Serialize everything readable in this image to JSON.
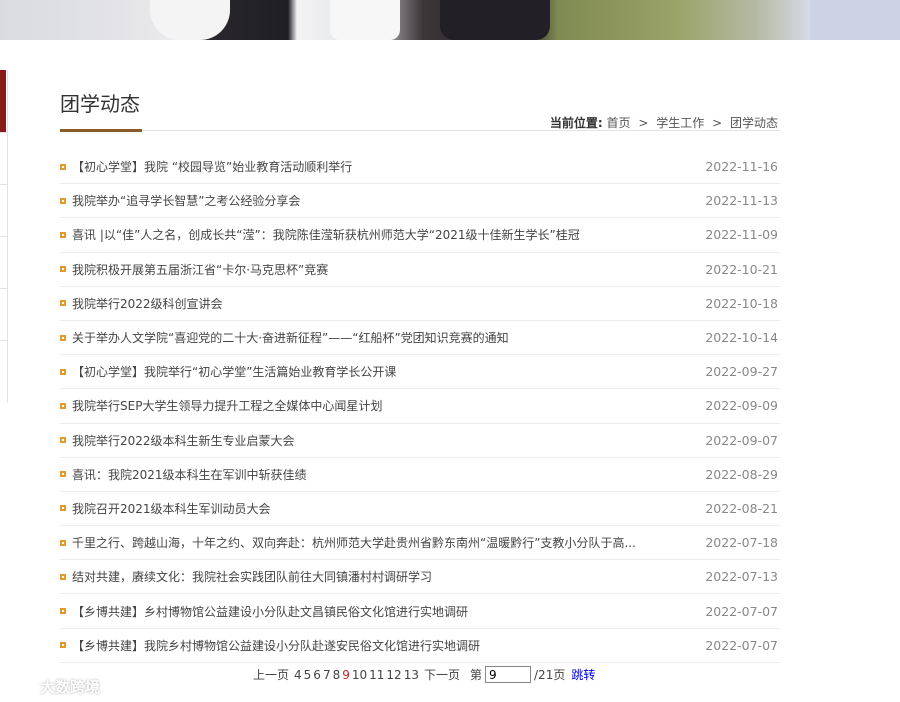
{
  "header": {
    "title": "团学动态",
    "breadcrumb_label": "当前位置:",
    "breadcrumb": [
      "首页",
      "学生工作",
      "团学动态"
    ],
    "breadcrumb_sep": ">"
  },
  "colors": {
    "accent": "#8b5a2b",
    "bullet": "#e39a2a",
    "current_page": "#c02626",
    "sidenav_active": "#8b1a1a"
  },
  "news": [
    {
      "title": "【初心学堂】我院 “校园导览”始业教育活动顺利举行",
      "date": "2022-11-16"
    },
    {
      "title": "我院举办“追寻学长智慧”之考公经验分享会",
      "date": "2022-11-13"
    },
    {
      "title": "喜讯 |以“佳”人之名，创成长共“滢”：我院陈佳滢斩获杭州师范大学“2021级十佳新生学长”桂冠",
      "date": "2022-11-09"
    },
    {
      "title": "我院积极开展第五届浙江省“卡尔·马克思杯”竞赛",
      "date": "2022-10-21"
    },
    {
      "title": "我院举行2022级科创宣讲会",
      "date": "2022-10-18"
    },
    {
      "title": "关于举办人文学院“喜迎党的二十大·奋进新征程”——“红船杯”党团知识竞赛的通知",
      "date": "2022-10-14"
    },
    {
      "title": "【初心学堂】我院举行“初心学堂”生活篇始业教育学长公开课",
      "date": "2022-09-27"
    },
    {
      "title": "我院举行SEP大学生领导力提升工程之全媒体中心闻星计划",
      "date": "2022-09-09"
    },
    {
      "title": "我院举行2022级本科生新生专业启蒙大会",
      "date": "2022-09-07"
    },
    {
      "title": "喜讯：我院2021级本科生在军训中斩获佳绩",
      "date": "2022-08-29"
    },
    {
      "title": "我院召开2021级本科生军训动员大会",
      "date": "2022-08-21"
    },
    {
      "title": "千里之行、跨越山海，十年之约、双向奔赴：杭州师范大学赴贵州省黔东南州“温暖黔行”支教小分队于高...",
      "date": "2022-07-18"
    },
    {
      "title": "结对共建，赓续文化：我院社会实践团队前往大同镇潘村村调研学习",
      "date": "2022-07-13"
    },
    {
      "title": "【乡博共建】乡村博物馆公益建设小分队赴文昌镇民俗文化馆进行实地调研",
      "date": "2022-07-07"
    },
    {
      "title": "【乡博共建】我院乡村博物馆公益建设小分队赴遂安民俗文化馆进行实地调研",
      "date": "2022-07-07"
    }
  ],
  "pagination": {
    "prev": "上一页",
    "pages": [
      "4",
      "5",
      "6",
      "7",
      "8",
      "9",
      "10",
      "11",
      "12",
      "13"
    ],
    "current": "9",
    "next": "下一页",
    "goto_prefix": "第",
    "goto_value": "9",
    "goto_suffix": "/21页",
    "jump": "跳转"
  },
  "watermark": {
    "text": "大数跨境",
    "icon": "logo-swirl-icon"
  }
}
